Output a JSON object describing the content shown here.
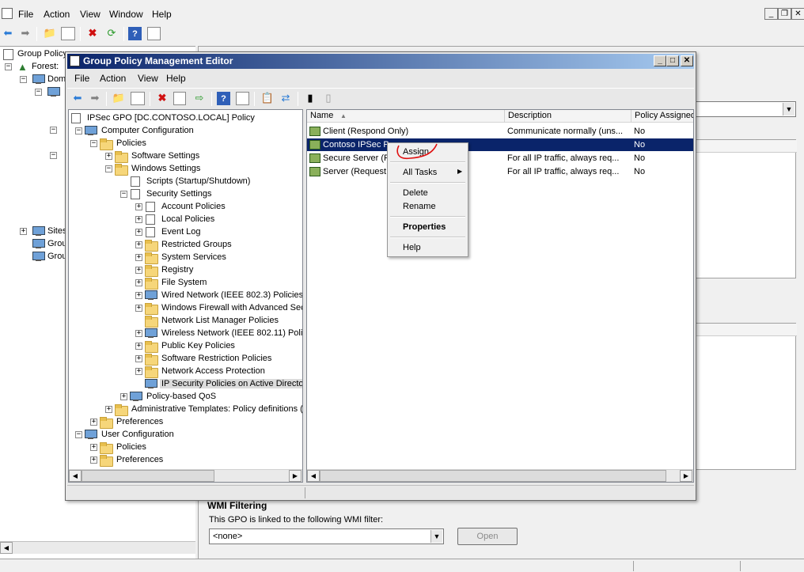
{
  "outer": {
    "menu": [
      "File",
      "Action",
      "View",
      "Window",
      "Help"
    ],
    "tree": {
      "root": "Group Policy",
      "forest": "Forest:",
      "domains": "Dom",
      "sites": "Sites",
      "item_a": "Grou",
      "item_b": "Grou"
    },
    "wmi": {
      "heading": "WMI Filtering",
      "desc": "This GPO is linked to the following WMI filter:",
      "value": "<none>",
      "open_button": "Open"
    }
  },
  "gpme": {
    "title": "Group Policy Management Editor",
    "menu": [
      "File",
      "Action",
      "View",
      "Help"
    ],
    "tree": [
      {
        "label": "IPSec GPO [DC.CONTOSO.LOCAL] Policy",
        "icon": "policy-doc-icon"
      },
      {
        "label": "Computer Configuration",
        "icon": "computer-icon"
      },
      {
        "label": "Policies",
        "icon": "folder-icon"
      },
      {
        "label": "Software Settings",
        "icon": "folder-icon"
      },
      {
        "label": "Windows Settings",
        "icon": "folder-icon"
      },
      {
        "label": "Scripts (Startup/Shutdown)",
        "icon": "script-icon"
      },
      {
        "label": "Security Settings",
        "icon": "security-icon"
      },
      {
        "label": "Account Policies",
        "icon": "policy-icon"
      },
      {
        "label": "Local Policies",
        "icon": "policy-icon"
      },
      {
        "label": "Event Log",
        "icon": "policy-icon"
      },
      {
        "label": "Restricted Groups",
        "icon": "folder-lock-icon"
      },
      {
        "label": "System Services",
        "icon": "folder-lock-icon"
      },
      {
        "label": "Registry",
        "icon": "folder-lock-icon"
      },
      {
        "label": "File System",
        "icon": "folder-lock-icon"
      },
      {
        "label": "Wired Network (IEEE 802.3) Policies",
        "icon": "network-icon"
      },
      {
        "label": "Windows Firewall with Advanced Sec",
        "icon": "folder-icon"
      },
      {
        "label": "Network List Manager Policies",
        "icon": "folder-icon"
      },
      {
        "label": "Wireless Network (IEEE 802.11) Polic",
        "icon": "wireless-icon"
      },
      {
        "label": "Public Key Policies",
        "icon": "folder-icon"
      },
      {
        "label": "Software Restriction Policies",
        "icon": "folder-icon"
      },
      {
        "label": "Network Access Protection",
        "icon": "folder-icon"
      },
      {
        "label": "IP Security Policies on Active Director",
        "icon": "ipsec-icon"
      },
      {
        "label": "Policy-based QoS",
        "icon": "qos-icon"
      },
      {
        "label": "Administrative Templates: Policy definitions (",
        "icon": "folder-icon"
      },
      {
        "label": "Preferences",
        "icon": "folder-icon"
      },
      {
        "label": "User Configuration",
        "icon": "user-icon"
      },
      {
        "label": "Policies",
        "icon": "folder-icon"
      },
      {
        "label": "Preferences",
        "icon": "folder-icon"
      }
    ],
    "list": {
      "columns": [
        "Name",
        "Description",
        "Policy Assigned"
      ],
      "rows": [
        {
          "name": "Client (Respond Only)",
          "desc": "Communicate normally (uns...",
          "assigned": "No"
        },
        {
          "name": "Contoso IPSec Po",
          "desc": "",
          "assigned": "No"
        },
        {
          "name": "Secure Server (R",
          "desc": "For all IP traffic, always req...",
          "assigned": "No"
        },
        {
          "name": "Server (Request",
          "desc": "For all IP traffic, always req...",
          "assigned": "No"
        }
      ]
    },
    "context_menu": {
      "assign": "Assign",
      "all_tasks": "All Tasks",
      "delete": "Delete",
      "rename": "Rename",
      "properties": "Properties",
      "help": "Help"
    }
  },
  "colors": {
    "title_gradient_start": "#0a246a",
    "selection": "#0a246a",
    "annotation": "#e01010"
  }
}
